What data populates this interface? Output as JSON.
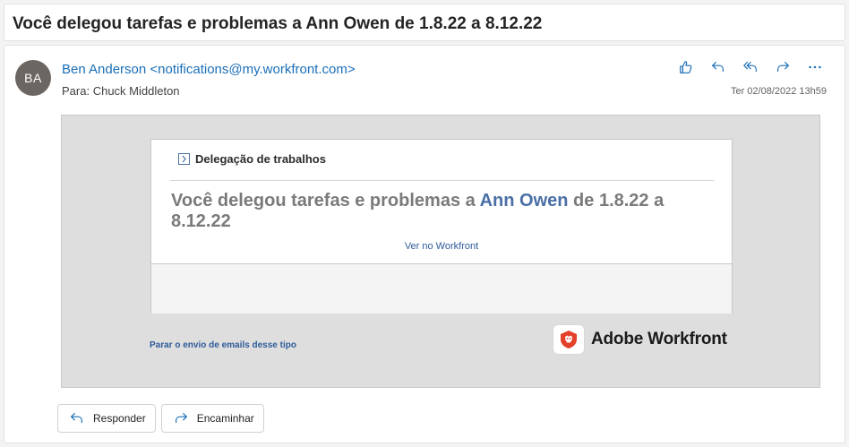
{
  "subject": "Você delegou tarefas e problemas a Ann Owen de 1.8.22 a 8.12.22",
  "header": {
    "avatar_initials": "BA",
    "sender": "Ben Anderson <notifications@my.workfront.com>",
    "to_label": "Para:",
    "to_name": "Chuck Middleton",
    "timestamp": "Ter 02/08/2022 13h59",
    "actions": [
      "like-icon",
      "reply-icon",
      "reply-all-icon",
      "forward-icon",
      "more-icon"
    ]
  },
  "body": {
    "section_title": "Delegação de trabalhos",
    "headline_prefix": "Você delegou tarefas e problemas a",
    "headline_name": "Ann Owen",
    "headline_suffix": "de 1.8.22 a 8.12.22",
    "view_link": "Ver no Workfront",
    "stop_link": "Parar o envio de emails desse tipo",
    "brand_name": "Adobe Workfront"
  },
  "reply_buttons": {
    "reply": "Responder",
    "forward": "Encaminhar"
  },
  "colors": {
    "accent": "#1a6fb8",
    "link": "#2d5b9a",
    "brand_red": "#e3412a",
    "body_bg": "#dedede"
  }
}
